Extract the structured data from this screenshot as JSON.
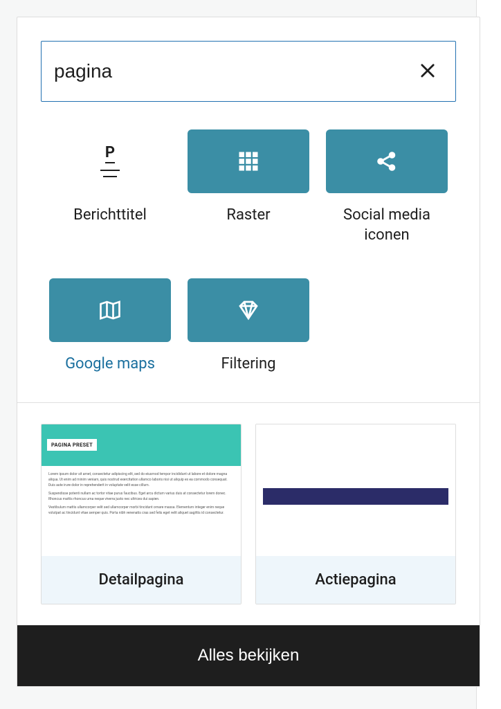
{
  "search": {
    "value": "pagina",
    "placeholder": ""
  },
  "blocks": [
    {
      "label": "Berichttitel",
      "icon": "post-title",
      "highlighted": false
    },
    {
      "label": "Raster",
      "icon": "grid",
      "highlighted": true
    },
    {
      "label": "Social media iconen",
      "icon": "share",
      "highlighted": true
    },
    {
      "label": "Google maps",
      "icon": "map",
      "highlighted": true,
      "link_style": true
    },
    {
      "label": "Filtering",
      "icon": "diamond",
      "highlighted": true
    }
  ],
  "patterns": [
    {
      "label": "Detailpagina",
      "preset_title": "PAGINA PRESET"
    },
    {
      "label": "Actiepagina"
    }
  ],
  "view_all_label": "Alles bekijken",
  "colors": {
    "accent": "#2271b1",
    "block_teal": "#3b8ea5",
    "pattern_bg": "#eef6fb"
  }
}
